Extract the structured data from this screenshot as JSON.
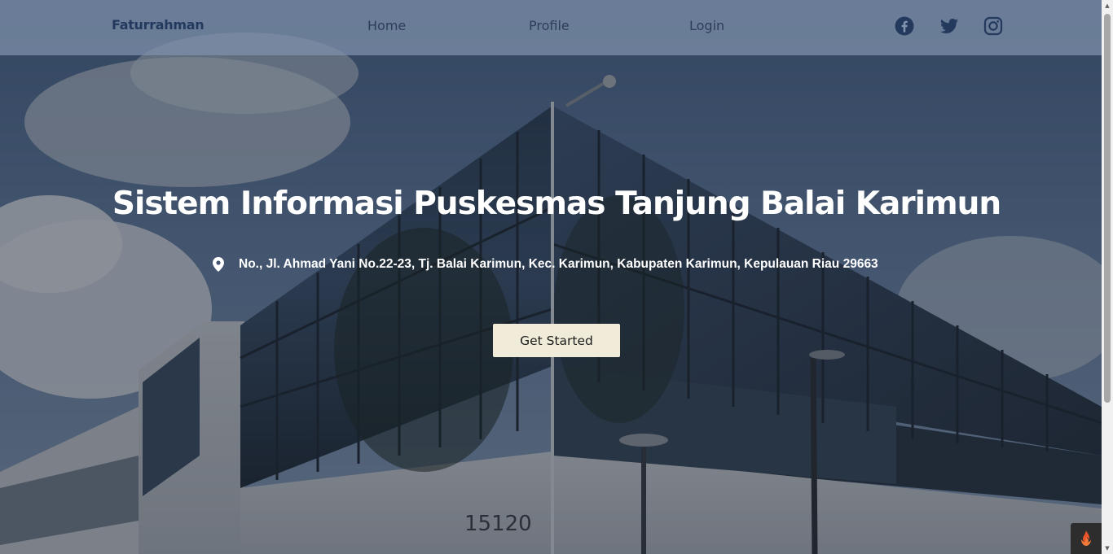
{
  "navbar": {
    "brand": "Faturrahman",
    "links": [
      {
        "label": "Home"
      },
      {
        "label": "Profile"
      },
      {
        "label": "Login"
      }
    ],
    "social": [
      {
        "icon": "facebook-icon"
      },
      {
        "icon": "twitter-icon"
      },
      {
        "icon": "instagram-icon"
      }
    ]
  },
  "hero": {
    "title": "Sistem Informasi Puskesmas Tanjung Balai Karimun",
    "address_icon": "map-pin-icon",
    "address": "No., Jl. Ahmad Yani No.22-23, Tj. Balai Karimun, Kec. Karimun, Kabupaten Karimun, Kepulauan Riau 29663",
    "cta_label": "Get Started",
    "building_number": "15120"
  },
  "colors": {
    "navbar_bg": "#8092ac",
    "brand_text": "#233a5e",
    "nav_text": "#2c3e5a",
    "cta_bg": "#f1ecd9",
    "hero_text": "#ffffff"
  }
}
